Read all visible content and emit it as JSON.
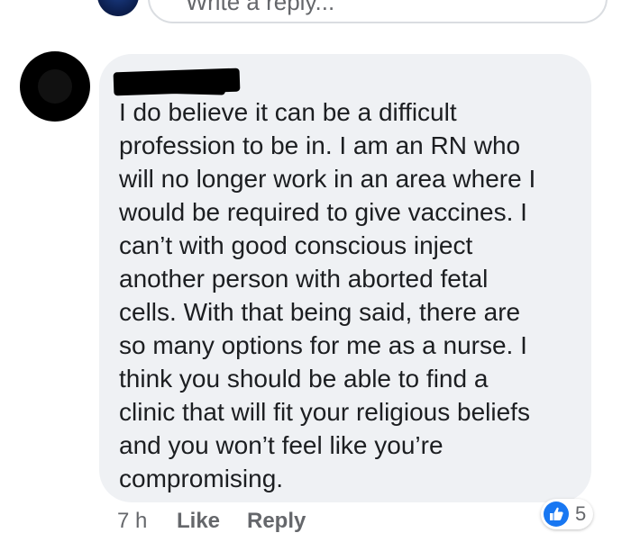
{
  "reply_box": {
    "placeholder": "Write a reply..."
  },
  "comment": {
    "text": "I do believe it can be a difficult\nprofession to be in. I am an RN who\nwill no longer work in an area where I\nwould be required to give vaccines. I\ncan’t with good conscious inject\nanother person with aborted fetal\ncells. With that being said, there are\nso many options for me as a nurse. I\nthink you should be able to find a\nclinic that will fit your religious beliefs\nand you won’t feel like you’re\ncompromising.",
    "timestamp": "7 h",
    "like_label": "Like",
    "reply_label": "Reply",
    "reaction_count": "5",
    "reaction_icon": "like-thumbs-up-icon"
  },
  "colors": {
    "bubble_bg": "#eff1f4",
    "text": "#1c1e21",
    "meta": "#65676b",
    "like_blue": "#1877f2"
  }
}
